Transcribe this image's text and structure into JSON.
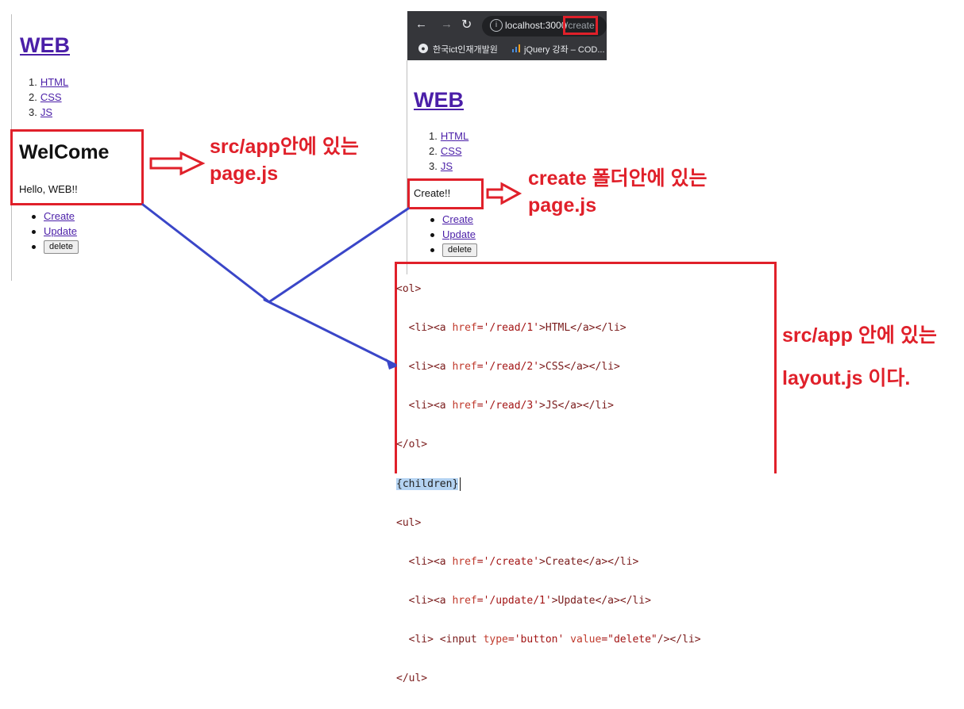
{
  "left_page": {
    "title": "WEB",
    "topics": [
      {
        "num": "1.",
        "label": "HTML"
      },
      {
        "num": "2.",
        "label": "CSS"
      },
      {
        "num": "3.",
        "label": "JS"
      }
    ],
    "heading": "WelCome",
    "body": "Hello, WEB!!",
    "links": [
      "Create",
      "Update"
    ],
    "delete_button": "delete"
  },
  "notes": {
    "note1_line1": "src/app안에 있는",
    "note1_line2": "page.js",
    "note2_line1": "create 폴더안에 있는",
    "note2_line2": "page.js",
    "note3_line1": "src/app 안에 있는",
    "note3_line2": "layout.js 이다."
  },
  "browser": {
    "host": "localhost:3000",
    "path": "/create",
    "bookmarks": [
      "한국ict인재개발원",
      "jQuery 강좌 – COD..."
    ]
  },
  "right_page": {
    "title": "WEB",
    "topics": [
      {
        "num": "1.",
        "label": "HTML"
      },
      {
        "num": "2.",
        "label": "CSS"
      },
      {
        "num": "3.",
        "label": "JS"
      }
    ],
    "body": "Create!!",
    "links": [
      "Create",
      "Update"
    ],
    "delete_button": "delete"
  },
  "code": {
    "ol_open": "<ol>",
    "li1_open": "<li><a ",
    "li1_attr": "href",
    "li1_val": "='/read/1'",
    "li1_rest": ">HTML</a></li>",
    "li2_val": "='/read/2'",
    "li2_rest": ">CSS</a></li>",
    "li3_val": "='/read/3'",
    "li3_rest": ">JS</a></li>",
    "ol_close": "</ol>",
    "children": "{children}",
    "ul_open": "<ul>",
    "c_val": "='/create'",
    "c_rest": ">Create</a></li>",
    "u_val": "='/update/1'",
    "u_rest": ">Update</a></li>",
    "d_open": "<li> <input ",
    "d_type": "type",
    "d_type_val": "='button' ",
    "d_value": "value",
    "d_value_val": "=\"delete\"",
    "d_close": "/></li>",
    "ul_close": "</ul>"
  },
  "colors": {
    "annotation_red": "#e0202a",
    "annotation_blue": "#3a46c8",
    "link": "#4b1fa8"
  }
}
